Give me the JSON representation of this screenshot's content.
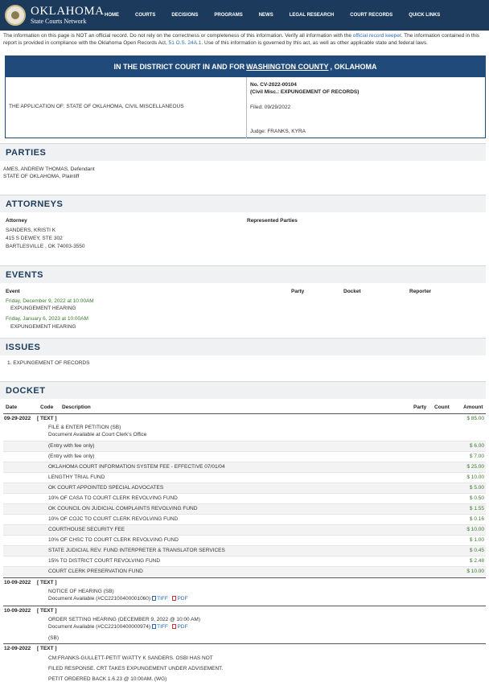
{
  "header": {
    "logo_title": "OKLAHOMA",
    "logo_subtitle": "State Courts Network",
    "menu": [
      "HOME",
      "COURTS",
      "DECISIONS",
      "PROGRAMS",
      "NEWS",
      "LEGAL RESEARCH",
      "COURT RECORDS",
      "QUICK LINKS"
    ]
  },
  "notice": {
    "part1": "The information on this page is NOT an official record. Do not rely on the correctness or completeness of this information. Verify all information with the ",
    "link1": "official record keeper",
    "part2": ". The information contained in this report is provided in compliance with the Oklahoma Open Records Act, ",
    "link2": "51 O.S. 24A.1",
    "part3": ". Use of this information is governed by this act, as well as other applicable state and federal laws."
  },
  "case": {
    "banner_pre": "IN THE DISTRICT COURT IN AND FOR",
    "banner_county": "WASHINGTON COUNTY",
    "banner_post": ", OKLAHOMA",
    "style": "THE APPLICATION OF: STATE OF OKLAHOMA, CIVIL MISCELLANEOUS",
    "number": "No. CV-2022-00104",
    "type": "(Civil Misc.: EXPUNGEMENT OF RECORDS)",
    "filed": "Filed: 09/29/2022",
    "judge": "Judge: FRANKS, KYRA"
  },
  "parties": {
    "title": "PARTIES",
    "lines": [
      "AMES,  ANDREW  THOMAS, Defendant",
      "STATE OF OKLAHOMA, Plaintiff"
    ]
  },
  "attorneys": {
    "title": "ATTORNEYS",
    "col_attorney": "Attorney",
    "col_parties": "Represented Parties",
    "lines": [
      "SANDERS, KRISTI K",
      "415 S DEWEY, STE 302",
      "BARTLESVILLE , OK 74003-3550"
    ]
  },
  "events": {
    "title": "EVENTS",
    "cols": [
      "Event",
      "Party",
      "Docket",
      "Reporter"
    ],
    "items": [
      {
        "when": "Friday, December 9, 2022 at 10:00AM",
        "what": "EXPUNGEMENT HEARING"
      },
      {
        "when": "Friday, January 6, 2023 at 10:00AM",
        "what": "EXPUNGEMENT HEARING"
      }
    ]
  },
  "issues": {
    "title": "ISSUES",
    "items": [
      "1.  EXPUNGEMENT OF RECORDS"
    ]
  },
  "docket": {
    "title": "DOCKET",
    "cols": [
      "Date",
      "Code",
      "Description",
      "Party",
      "Count",
      "Amount"
    ],
    "g1_date": "09-29-2022",
    "g1_code": "[ TEXT ]",
    "g1_amount": "$ 85.00",
    "g1_desc": "FILE & ENTER PETITION (SB)",
    "g1_sub": "Document Available at Court Clerk's Office",
    "fees": [
      {
        "desc": "(Entry with fee only)",
        "amt": "$ 6.00"
      },
      {
        "desc": "(Entry with fee only)",
        "amt": "$ 7.00"
      },
      {
        "desc": "OKLAHOMA COURT INFORMATION SYSTEM FEE - EFFECTIVE 07/01/04",
        "amt": "$ 25.00"
      },
      {
        "desc": "LENGTHY TRIAL FUND",
        "amt": "$ 10.00"
      },
      {
        "desc": "OK COURT APPOINTED SPECIAL ADVOCATES",
        "amt": "$ 5.00"
      },
      {
        "desc": "10% OF CASA TO COURT CLERK REVOLVING FUND",
        "amt": "$ 0.50"
      },
      {
        "desc": "OK COUNCIL ON JUDICIAL COMPLAINTS REVOLVING FUND",
        "amt": "$ 1.55"
      },
      {
        "desc": "10% OF COJC TO COURT CLERK REVOLVING FUND",
        "amt": "$ 0.16"
      },
      {
        "desc": "COURTHOUSE SECURITY FEE",
        "amt": "$ 10.00"
      },
      {
        "desc": "10% OF CHSC TO COURT CLERK REVOLVING FUND",
        "amt": "$ 1.00"
      },
      {
        "desc": "STATE JUDICIAL REV. FUND INTERPRETER & TRANSLATOR SERVICES",
        "amt": "$ 0.45"
      },
      {
        "desc": "15% TO DISTRICT COURT REVOLVING FUND",
        "amt": "$ 2.48"
      },
      {
        "desc": "COURT CLERK PRESERVATION FUND",
        "amt": "$ 10.00"
      }
    ],
    "g2_date": "10-09-2022",
    "g2_code": "[ TEXT ]",
    "g2_desc": "NOTICE OF HEARING (SB)",
    "g2_doc": "Document Available (#CC22100400001060)",
    "g3_date": "10-09-2022",
    "g3_code": "[ TEXT ]",
    "g3_desc": "ORDER SETTING HEARING (DECEMBER 9, 2022 @ 10:00 AM)",
    "g3_doc": "Document Available (#CC22100400000974)",
    "g3_extra": "(SB)",
    "g4_date": "12-09-2022",
    "g4_code": "[ TEXT ]",
    "g4_lines": [
      "CM:FRANKS-GULLETT-PETIT W/ATTY K SANDERS. OSBI HAS NOT",
      "FILED RESPONSE. CRT TAKES EXPUNGEMENT UNDER ADVISEMENT.",
      "PETIT ORDERED BACK 1.6.23 @ 10:00AM. (WG)"
    ],
    "tiff": "TIFF",
    "pdf": "PDF"
  }
}
